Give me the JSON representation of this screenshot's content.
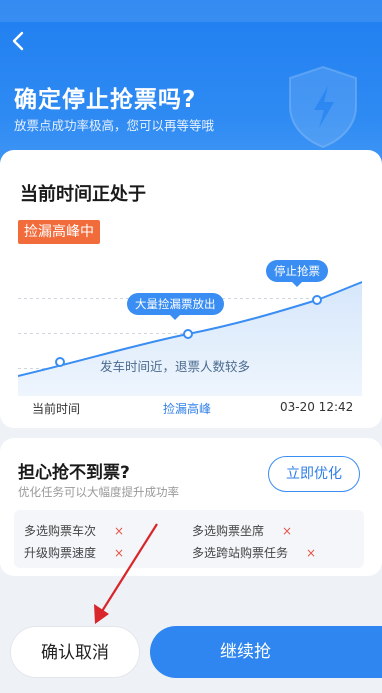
{
  "header": {
    "title": "确定停止抢票吗?",
    "subtitle": "放票点成功率极高，您可以再等等哦"
  },
  "status_card": {
    "title": "当前时间正处于",
    "badge": "捡漏高峰中",
    "chart_tags": [
      "大量捡漏票放出",
      "停止抢票"
    ],
    "chart_note": "发车时间近，退票人数较多",
    "axis_labels": [
      "当前时间",
      "捡漏高峰",
      "03-20 12:42"
    ]
  },
  "worry_card": {
    "title": "担心抢不到票?",
    "subtitle": "优化任务可以大幅度提升成功率",
    "optimize_label": "立即优化",
    "tasks": [
      {
        "label": "多选购票车次",
        "mark": "×"
      },
      {
        "label": "多选购票坐席",
        "mark": "×"
      },
      {
        "label": "升级购票速度",
        "mark": "×"
      },
      {
        "label": "多选跨站购票任务",
        "mark": "×"
      }
    ]
  },
  "footer": {
    "cancel_label": "确认取消",
    "continue_label": "继续抢"
  },
  "colors": {
    "primary": "#2f86f0",
    "badge": "#f26b3a",
    "danger": "#e2574c",
    "annotation": "#d9262b"
  }
}
